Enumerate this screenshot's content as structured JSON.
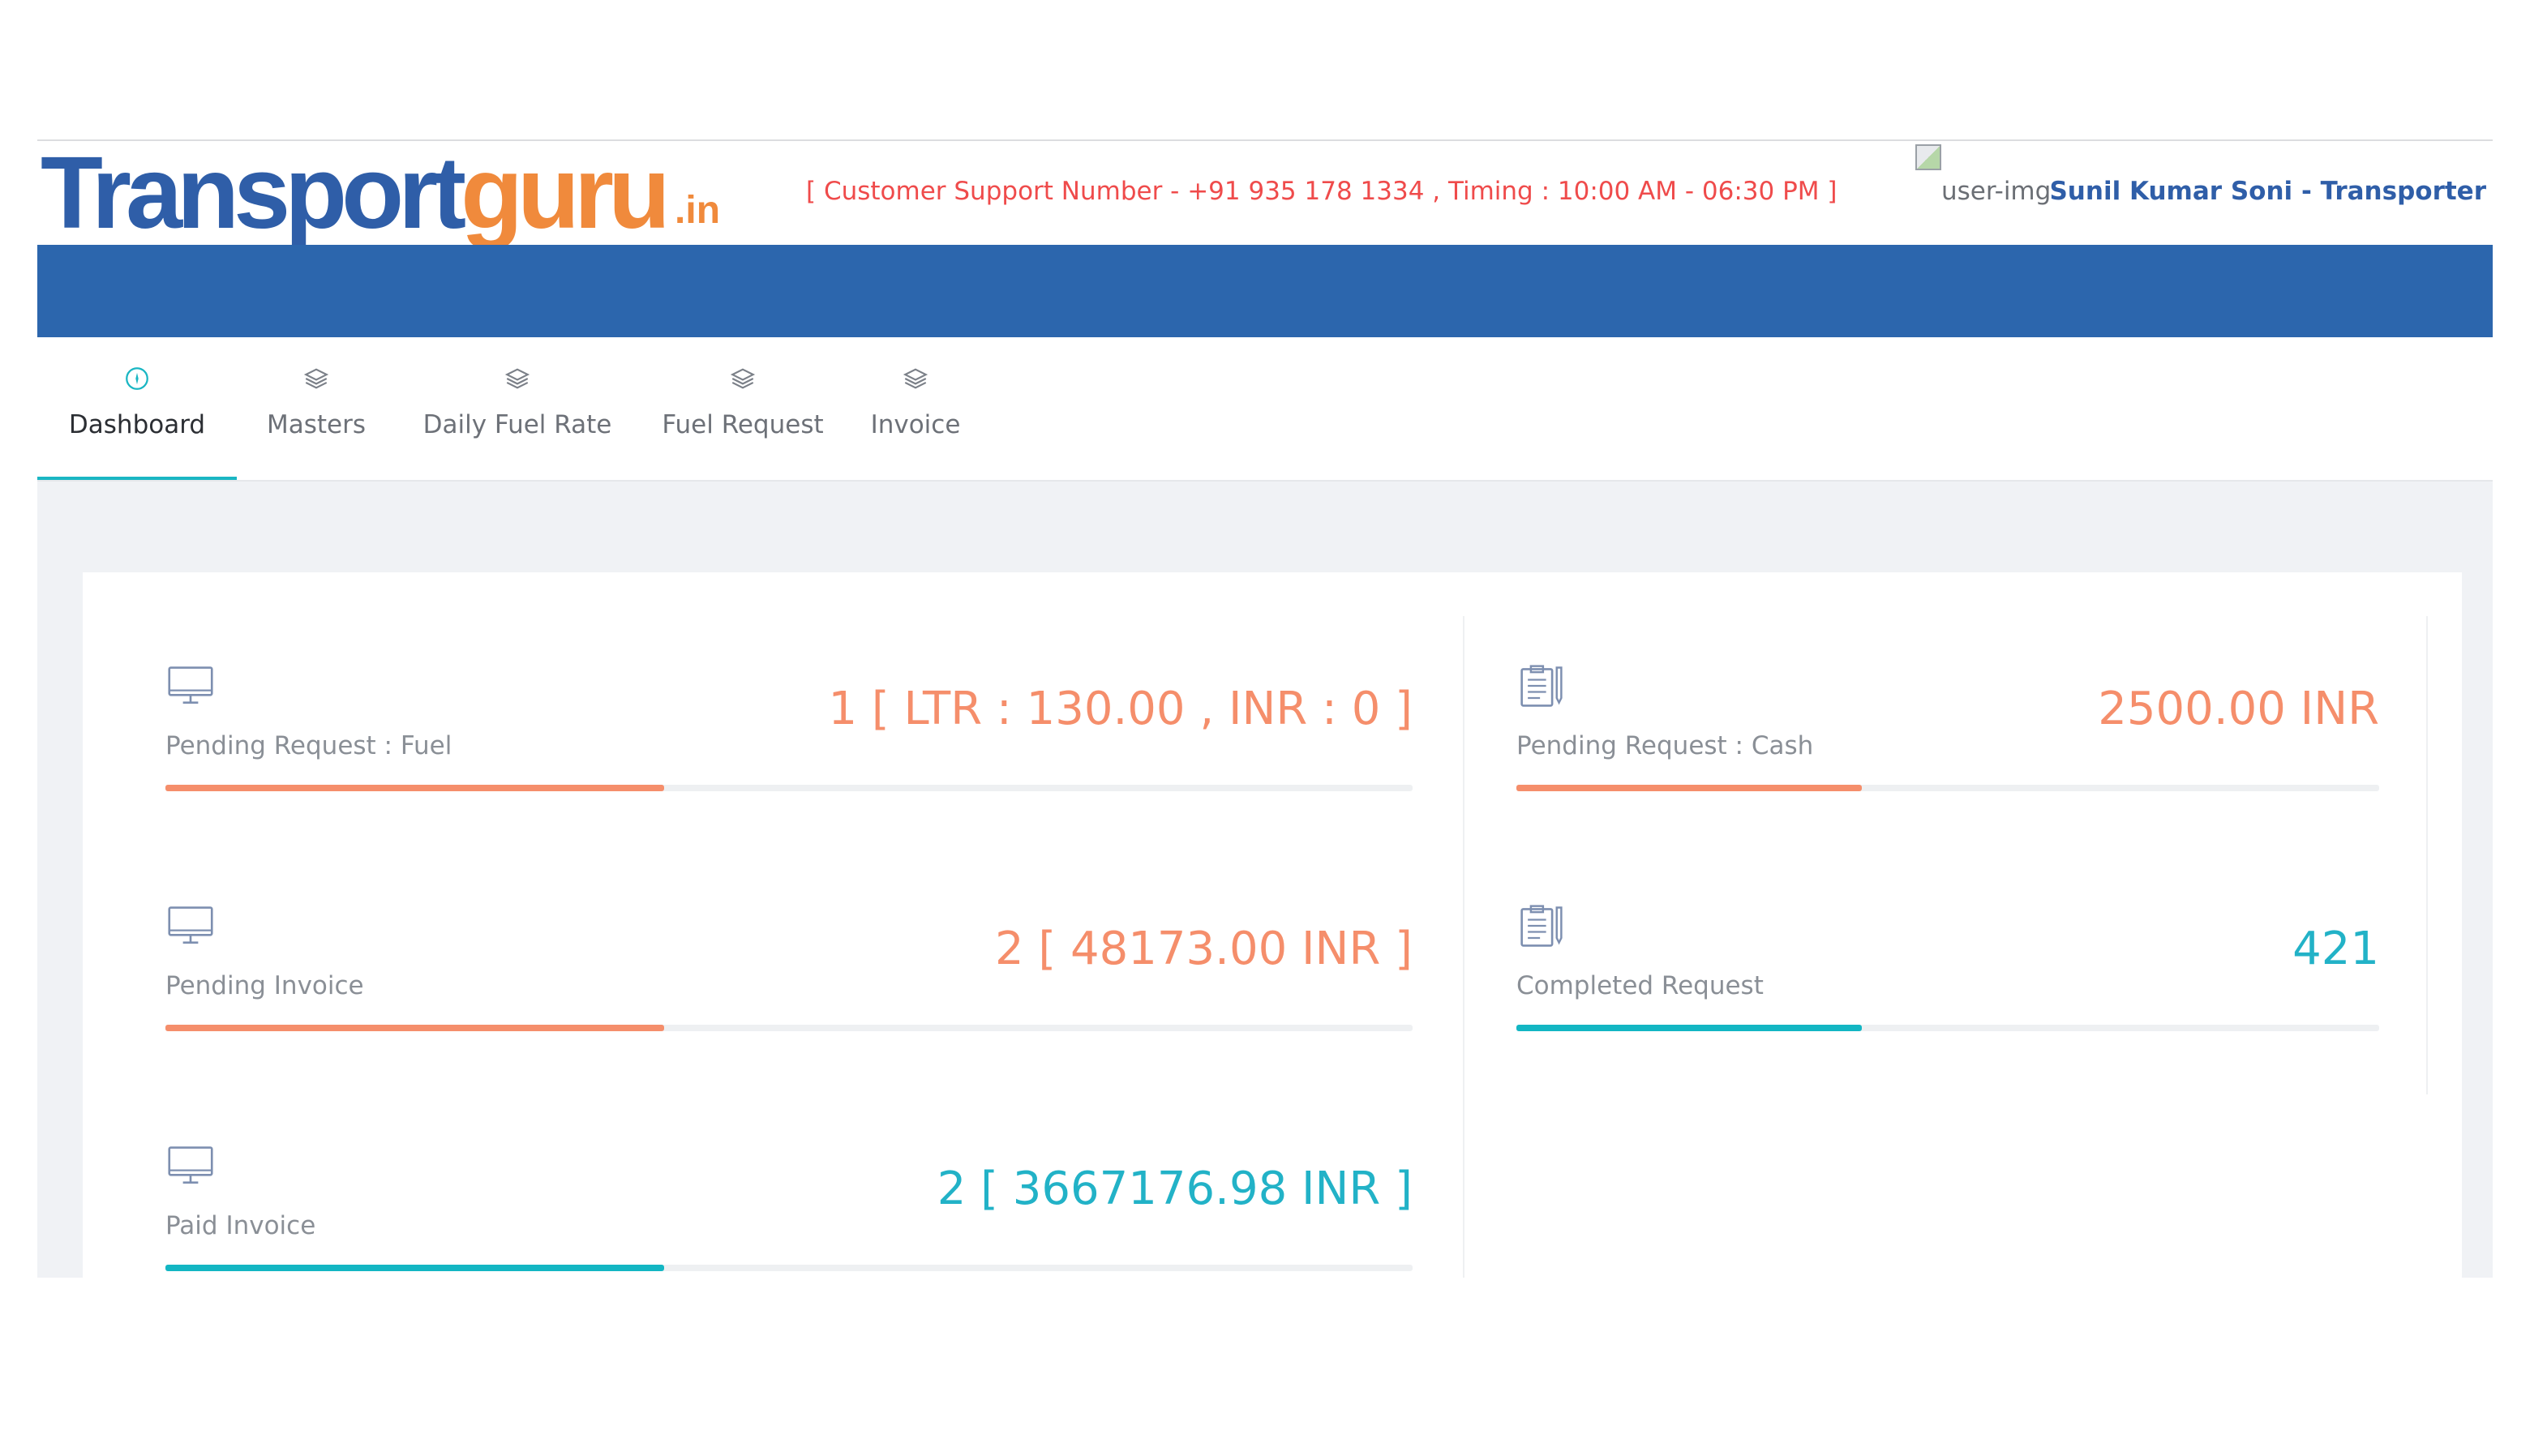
{
  "header": {
    "logo": {
      "part1": "Transport",
      "part2": "guru",
      "part3": ".in"
    },
    "support_text": "[ Customer Support Number - +91 935 178 1334 , Timing : 10:00 AM - 06:30 PM ]",
    "user_img_alt": "user-img",
    "user_name": "Sunil Kumar Soni - Transporter"
  },
  "nav": {
    "items": [
      {
        "label": "Dashboard",
        "icon": "compass-icon",
        "active": true
      },
      {
        "label": "Masters",
        "icon": "layers-icon",
        "active": false
      },
      {
        "label": "Daily Fuel Rate",
        "icon": "layers-icon",
        "active": false
      },
      {
        "label": "Fuel Request",
        "icon": "layers-icon",
        "active": false
      },
      {
        "label": "Invoice",
        "icon": "layers-icon",
        "active": false
      }
    ]
  },
  "colors": {
    "brand_blue": "#2c66ad",
    "brand_orange": "#f08a3c",
    "accent_teal": "#13b6c3",
    "accent_orange": "#f58e6b",
    "support_red": "#ef4b4b"
  },
  "stats": [
    {
      "label": "Pending Request : Fuel",
      "value": "1 [ LTR : 130.00 , INR : 0 ]",
      "icon": "monitor-icon",
      "tone": "orange",
      "progress": 0.4
    },
    {
      "label": "Pending Request : Cash",
      "value": "2500.00 INR",
      "icon": "clipboard-icon",
      "tone": "orange",
      "progress": 0.4
    },
    {
      "label": "Pending Invoice",
      "value": "2 [ 48173.00 INR ]",
      "icon": "monitor-icon",
      "tone": "orange",
      "progress": 0.4
    },
    {
      "label": "Completed Request",
      "value": "421",
      "icon": "clipboard-icon",
      "tone": "teal",
      "progress": 0.4
    },
    {
      "label": "Paid Invoice",
      "value": "2 [ 3667176.98 INR ]",
      "icon": "monitor-icon",
      "tone": "teal",
      "progress": 0.4
    }
  ]
}
